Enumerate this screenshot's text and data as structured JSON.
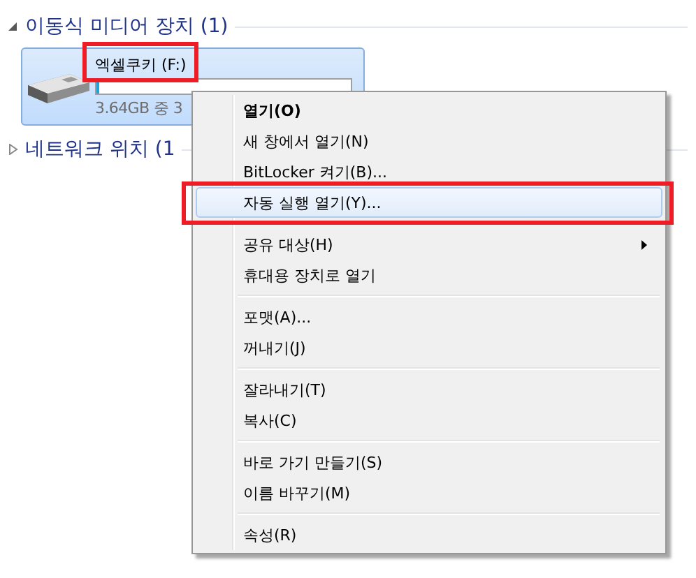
{
  "groups": [
    {
      "title": "이동식 미디어 장치 (1)",
      "expanded": true
    },
    {
      "title": "네트워크 위치 (1",
      "expanded": false
    }
  ],
  "drive": {
    "name": "엑셀쿠키 (F:)",
    "name_marked": true,
    "selected": true,
    "level": 0.01,
    "space": "3.64GB 중 3"
  },
  "context_menu": {
    "items": [
      {
        "kind": "item",
        "label": "열기(O)",
        "bold": true,
        "selected": false,
        "marked": false
      },
      {
        "kind": "item",
        "label": "새 창에서 열기(N)",
        "bold": false,
        "selected": false,
        "marked": false
      },
      {
        "kind": "item",
        "label": "BitLocker 켜기(B)...",
        "bold": false,
        "selected": false,
        "marked": false
      },
      {
        "kind": "item",
        "label": "자동 실행 열기(Y)...",
        "bold": false,
        "selected": true,
        "marked": true
      },
      {
        "kind": "separator"
      },
      {
        "kind": "submenu",
        "label": "공유 대상(H)",
        "bold": false,
        "selected": false,
        "marked": false
      },
      {
        "kind": "item",
        "label": "휴대용 장치로 열기",
        "bold": false,
        "selected": false,
        "marked": false
      },
      {
        "kind": "separator"
      },
      {
        "kind": "item",
        "label": "포맷(A)...",
        "bold": false,
        "selected": false,
        "marked": false
      },
      {
        "kind": "item",
        "label": "꺼내기(J)",
        "bold": false,
        "selected": false,
        "marked": false
      },
      {
        "kind": "separator"
      },
      {
        "kind": "item",
        "label": "잘라내기(T)",
        "bold": false,
        "selected": false,
        "marked": false
      },
      {
        "kind": "item",
        "label": "복사(C)",
        "bold": false,
        "selected": false,
        "marked": false
      },
      {
        "kind": "separator"
      },
      {
        "kind": "item",
        "label": "바로 가기 만들기(S)",
        "bold": false,
        "selected": false,
        "marked": false
      },
      {
        "kind": "item",
        "label": "이름 바꾸기(M)",
        "bold": false,
        "selected": false,
        "marked": false
      },
      {
        "kind": "separator"
      },
      {
        "kind": "item",
        "label": "속성(R)",
        "bold": false,
        "selected": false,
        "marked": false
      }
    ]
  }
}
